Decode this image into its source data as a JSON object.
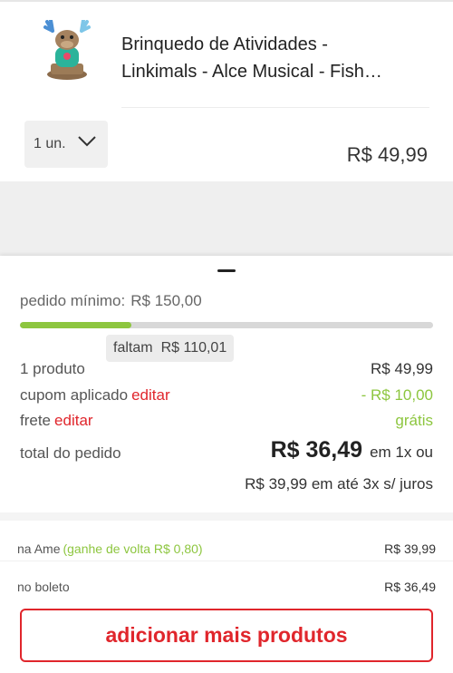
{
  "product": {
    "name_line1": "Brinquedo de Atividades -",
    "name_line2": "Linkimals - Alce Musical - Fish…",
    "image": "moose-toy-thumbnail",
    "quantity_label": "1 un.",
    "unit_price": "R$ 49,99"
  },
  "summary": {
    "min_order_label": "pedido mínimo:",
    "min_order_value": "R$ 150,00",
    "progress_fraction": 0.27,
    "remaining_label": "faltam",
    "remaining_value": "R$ 110,01",
    "products_label": "1 produto",
    "products_value": "R$ 49,99",
    "coupon_label": "cupom aplicado",
    "coupon_edit": "editar",
    "coupon_value": "- R$ 10,00",
    "shipping_label": "frete",
    "shipping_edit": "editar",
    "shipping_value": "grátis",
    "total_label": "total do pedido",
    "total_value": "R$ 36,49",
    "total_suffix": "em 1x ou",
    "installments": "R$ 39,99 em até 3x s/ juros"
  },
  "payment_options": [
    {
      "label": "na Ame",
      "bonus": "(ganhe de volta R$ 0,80)",
      "price": "R$ 39,99"
    },
    {
      "label": "no boleto",
      "bonus": "",
      "price": "R$ 36,49"
    }
  ],
  "actions": {
    "add_more": "adicionar mais produtos"
  },
  "colors": {
    "accent_red": "#e0262c",
    "accent_green": "#8dc63f"
  }
}
